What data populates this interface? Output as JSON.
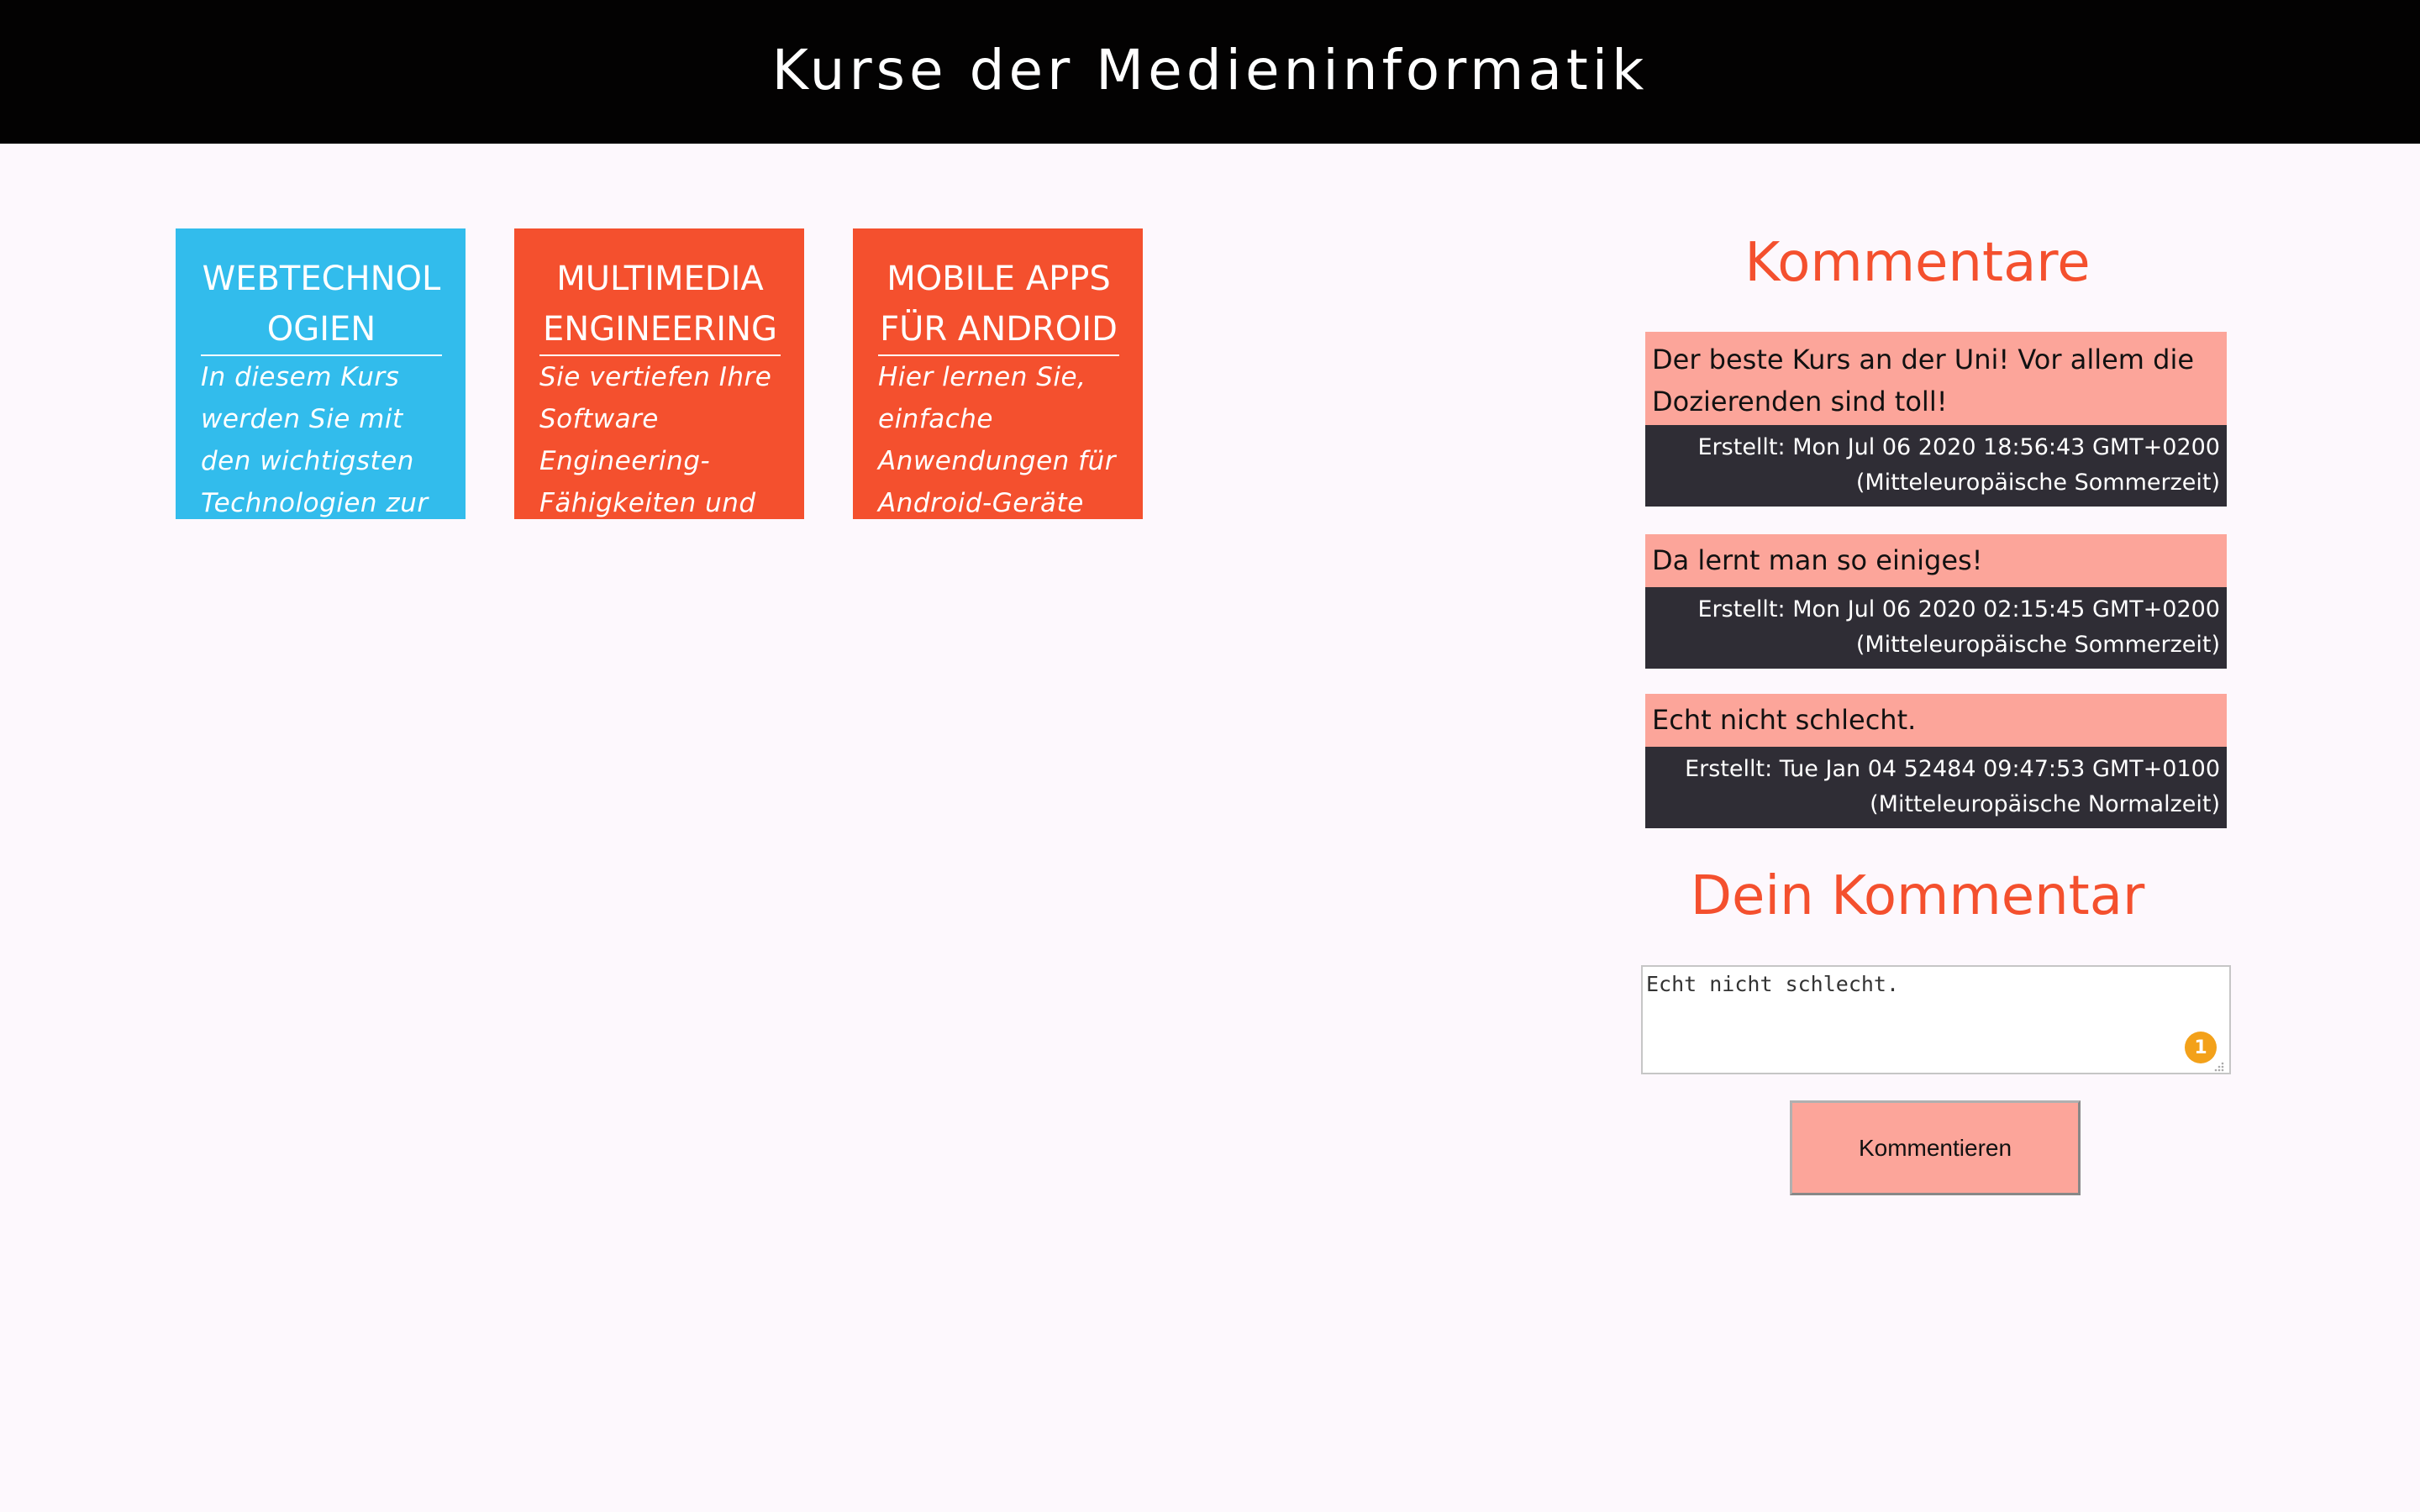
{
  "header": {
    "title": "Kurse der Medieninformatik"
  },
  "courses": [
    {
      "title": "WEBTECHNOLOGIEN",
      "description": "In diesem Kurs werden Sie mit den wichtigsten Technologien zur",
      "color": "#32bcec"
    },
    {
      "title": "MULTIMEDIA ENGINEERING",
      "description": "Sie vertiefen Ihre Software Engineering-Fähigkeiten und",
      "color": "#f4502e"
    },
    {
      "title": "MOBILE APPS FÜR ANDROID",
      "description": "Hier lernen Sie, einfache Anwendungen für Android-Geräte",
      "color": "#f4502e"
    }
  ],
  "comments": {
    "heading": "Kommentare",
    "items": [
      {
        "text": "Der beste Kurs an der Uni! Vor allem die Dozierenden sind toll!",
        "created": "Erstellt: Mon Jul 06 2020 18:56:43 GMT+0200 (Mitteleuropäische Sommerzeit)"
      },
      {
        "text": "Da lernt man so einiges!",
        "created": "Erstellt: Mon Jul 06 2020 02:15:45 GMT+0200 (Mitteleuropäische Sommerzeit)"
      },
      {
        "text": "Echt nicht schlecht.",
        "created": "Erstellt: Tue Jan 04 52484 09:47:53 GMT+0100 (Mitteleuropäische Normalzeit)"
      }
    ]
  },
  "your_comment": {
    "heading": "Dein Kommentar",
    "value": "Echt nicht schlecht.",
    "badge_count": "1",
    "submit_label": "Kommentieren"
  },
  "colors": {
    "accent": "#f4502e",
    "comment_bg": "#fca59a",
    "meta_bg": "#2f2d35",
    "header_bg": "#030202",
    "badge": "#f3a11a"
  }
}
